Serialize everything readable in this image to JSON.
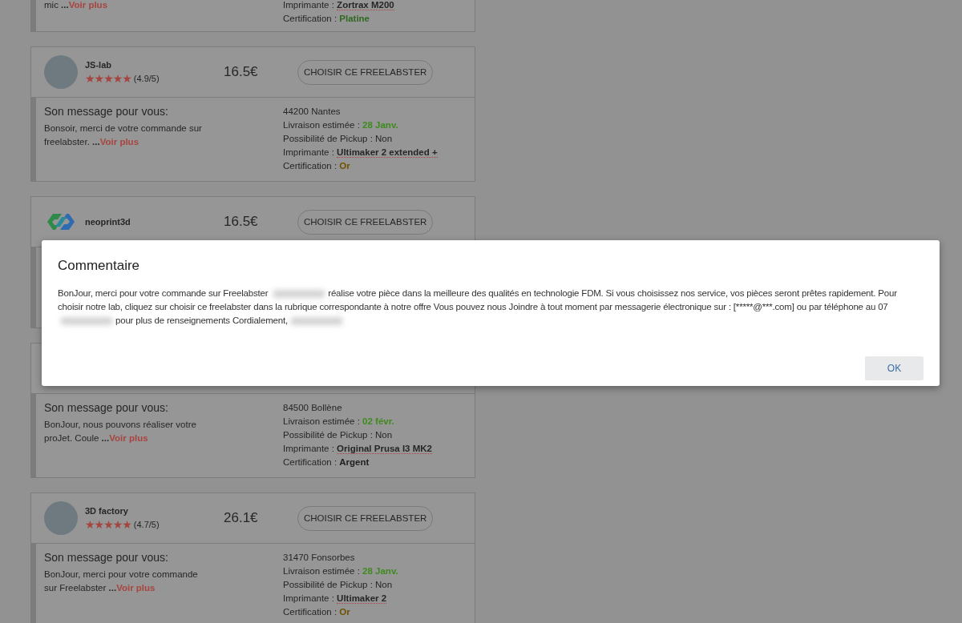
{
  "cards": [
    {
      "message": {
        "text": "mic",
        "ellipsis": "...",
        "more": "Voir plus"
      },
      "details": [
        {
          "kind": "printer",
          "label": "Imprimante :",
          "value": "Zortrax M200"
        },
        {
          "kind": "certification",
          "label": "Certification :",
          "value": "Platine",
          "color": "#2f6a22"
        }
      ]
    },
    {
      "header": {
        "avatar": {
          "kind": "photo"
        },
        "name": "JS-lab",
        "stars": 5,
        "rating": "(4.9/5)",
        "price": "16.5€",
        "button": "CHOISIR CE FREELABSTER"
      },
      "message": {
        "title": "Son message pour vous:",
        "text": "Bonsoir, merci de votre commande sur freelabster.",
        "ellipsis": "...",
        "more": "Voir plus"
      },
      "details": [
        {
          "kind": "plain",
          "text": "44200 Nantes"
        },
        {
          "kind": "delivery",
          "label": "Livraison estimée :",
          "value": "28 Janv."
        },
        {
          "kind": "plain",
          "text": "Possibilité de Pickup : Non"
        },
        {
          "kind": "printer",
          "label": "Imprimante :",
          "value": "Ultimaker 2 extended +"
        },
        {
          "kind": "certification",
          "label": "Certification :",
          "value": "Or",
          "color": "#6e5200"
        }
      ]
    },
    {
      "header": {
        "avatar": {
          "kind": "logo"
        },
        "name": "neoprint3d",
        "price": "16.5€",
        "button": "CHOISIR CE FREELABSTER"
      }
    },
    {
      "message": {
        "title": "Son message pour vous:",
        "text": "BonJour, nous pouvons réaliser votre proJet. Coule",
        "ellipsis": "...",
        "more": "Voir plus"
      },
      "details": [
        {
          "kind": "plain",
          "text": "84500 Bollène"
        },
        {
          "kind": "delivery",
          "label": "Livraison estimée :",
          "value": "02 févr."
        },
        {
          "kind": "plain",
          "text": "Possibilité de Pickup : Non"
        },
        {
          "kind": "printer",
          "label": "Imprimante :",
          "value": "Original Prusa I3 MK2"
        },
        {
          "kind": "certification",
          "label": "Certification :",
          "value": "Argent",
          "color": "#1e1e1e"
        }
      ]
    },
    {
      "header": {
        "avatar": {
          "kind": "photo"
        },
        "name": "3D factory",
        "stars": 5,
        "rating": "(4.7/5)",
        "price": "26.1€",
        "button": "CHOISIR CE FREELABSTER"
      },
      "message": {
        "title": "Son message pour vous:",
        "text": "BonJour, merci pour votre commande sur Freelabster",
        "ellipsis": "...",
        "more": "Voir plus"
      },
      "details": [
        {
          "kind": "plain",
          "text": "31470 Fonsorbes"
        },
        {
          "kind": "delivery",
          "label": "Livraison estimée :",
          "value": "28 Janv."
        },
        {
          "kind": "plain",
          "text": "Possibilité de Pickup : Non"
        },
        {
          "kind": "printer",
          "label": "Imprimante :",
          "value": "Ultimaker 2"
        },
        {
          "kind": "certification",
          "label": "Certification :",
          "value": "Or",
          "color": "#6e5200"
        }
      ]
    }
  ],
  "dialog": {
    "title": "Commentaire",
    "segments": [
      {
        "kind": "text",
        "text": "BonJour, merci pour votre commande sur Freelabster "
      },
      {
        "kind": "redacted"
      },
      {
        "kind": "text",
        "text": "réalise votre pièce dans la meilleure des qualités en technologie FDM. Si vous choisissez nos service, vos pièces seront prêtes rapidement. Pour choisir notre lab, cliquez sur choisir ce freelabster dans la rubrique correspondante à notre offre Vous pouvez nous Joindre à tout moment par messagerie électronique sur : [*****@***.com] ou par téléphone au 07"
      },
      {
        "kind": "redacted"
      },
      {
        "kind": "text",
        "text": "pour plus de renseignements Cordialement,"
      },
      {
        "kind": "redacted"
      }
    ],
    "button": "OK"
  }
}
